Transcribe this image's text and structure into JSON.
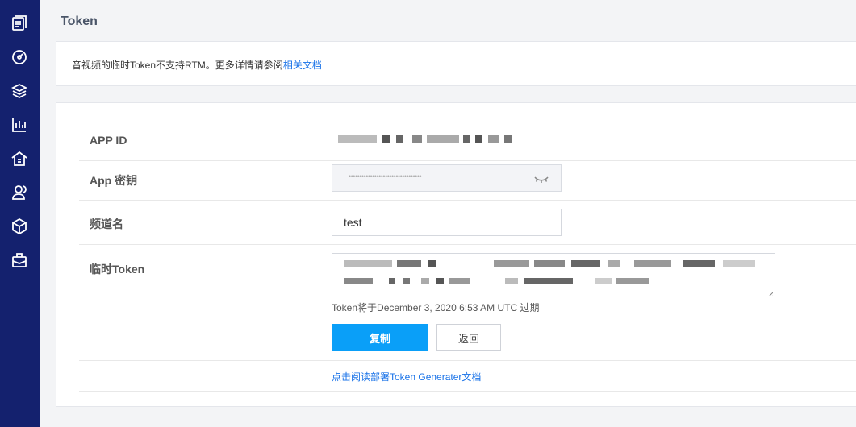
{
  "sidebar": {
    "icons": [
      "list-icon",
      "gauge-icon",
      "layers-icon",
      "bar-chart-icon",
      "pricing-house-icon",
      "users-icon",
      "box-icon",
      "briefcase-icon"
    ]
  },
  "page": {
    "title": "Token"
  },
  "notice": {
    "text": "音视频的临时Token不支持RTM。更多详情请参阅",
    "link": "相关文档"
  },
  "form": {
    "app_id_label": "APP ID",
    "app_secret_label": "App 密钥",
    "app_secret_masked": "••••••••••••••••••••••••••••••••••",
    "channel_label": "频道名",
    "channel_value": "test",
    "token_label": "临时Token",
    "expire_text": "Token将于December 3, 2020 6:53 AM UTC 过期",
    "copy_button": "复制",
    "back_button": "返回",
    "doc_link": "点击阅读部署Token Generater文档"
  },
  "colors": {
    "sidebar": "#14216e",
    "accent": "#0a9ff8",
    "link": "#1a73e8"
  }
}
